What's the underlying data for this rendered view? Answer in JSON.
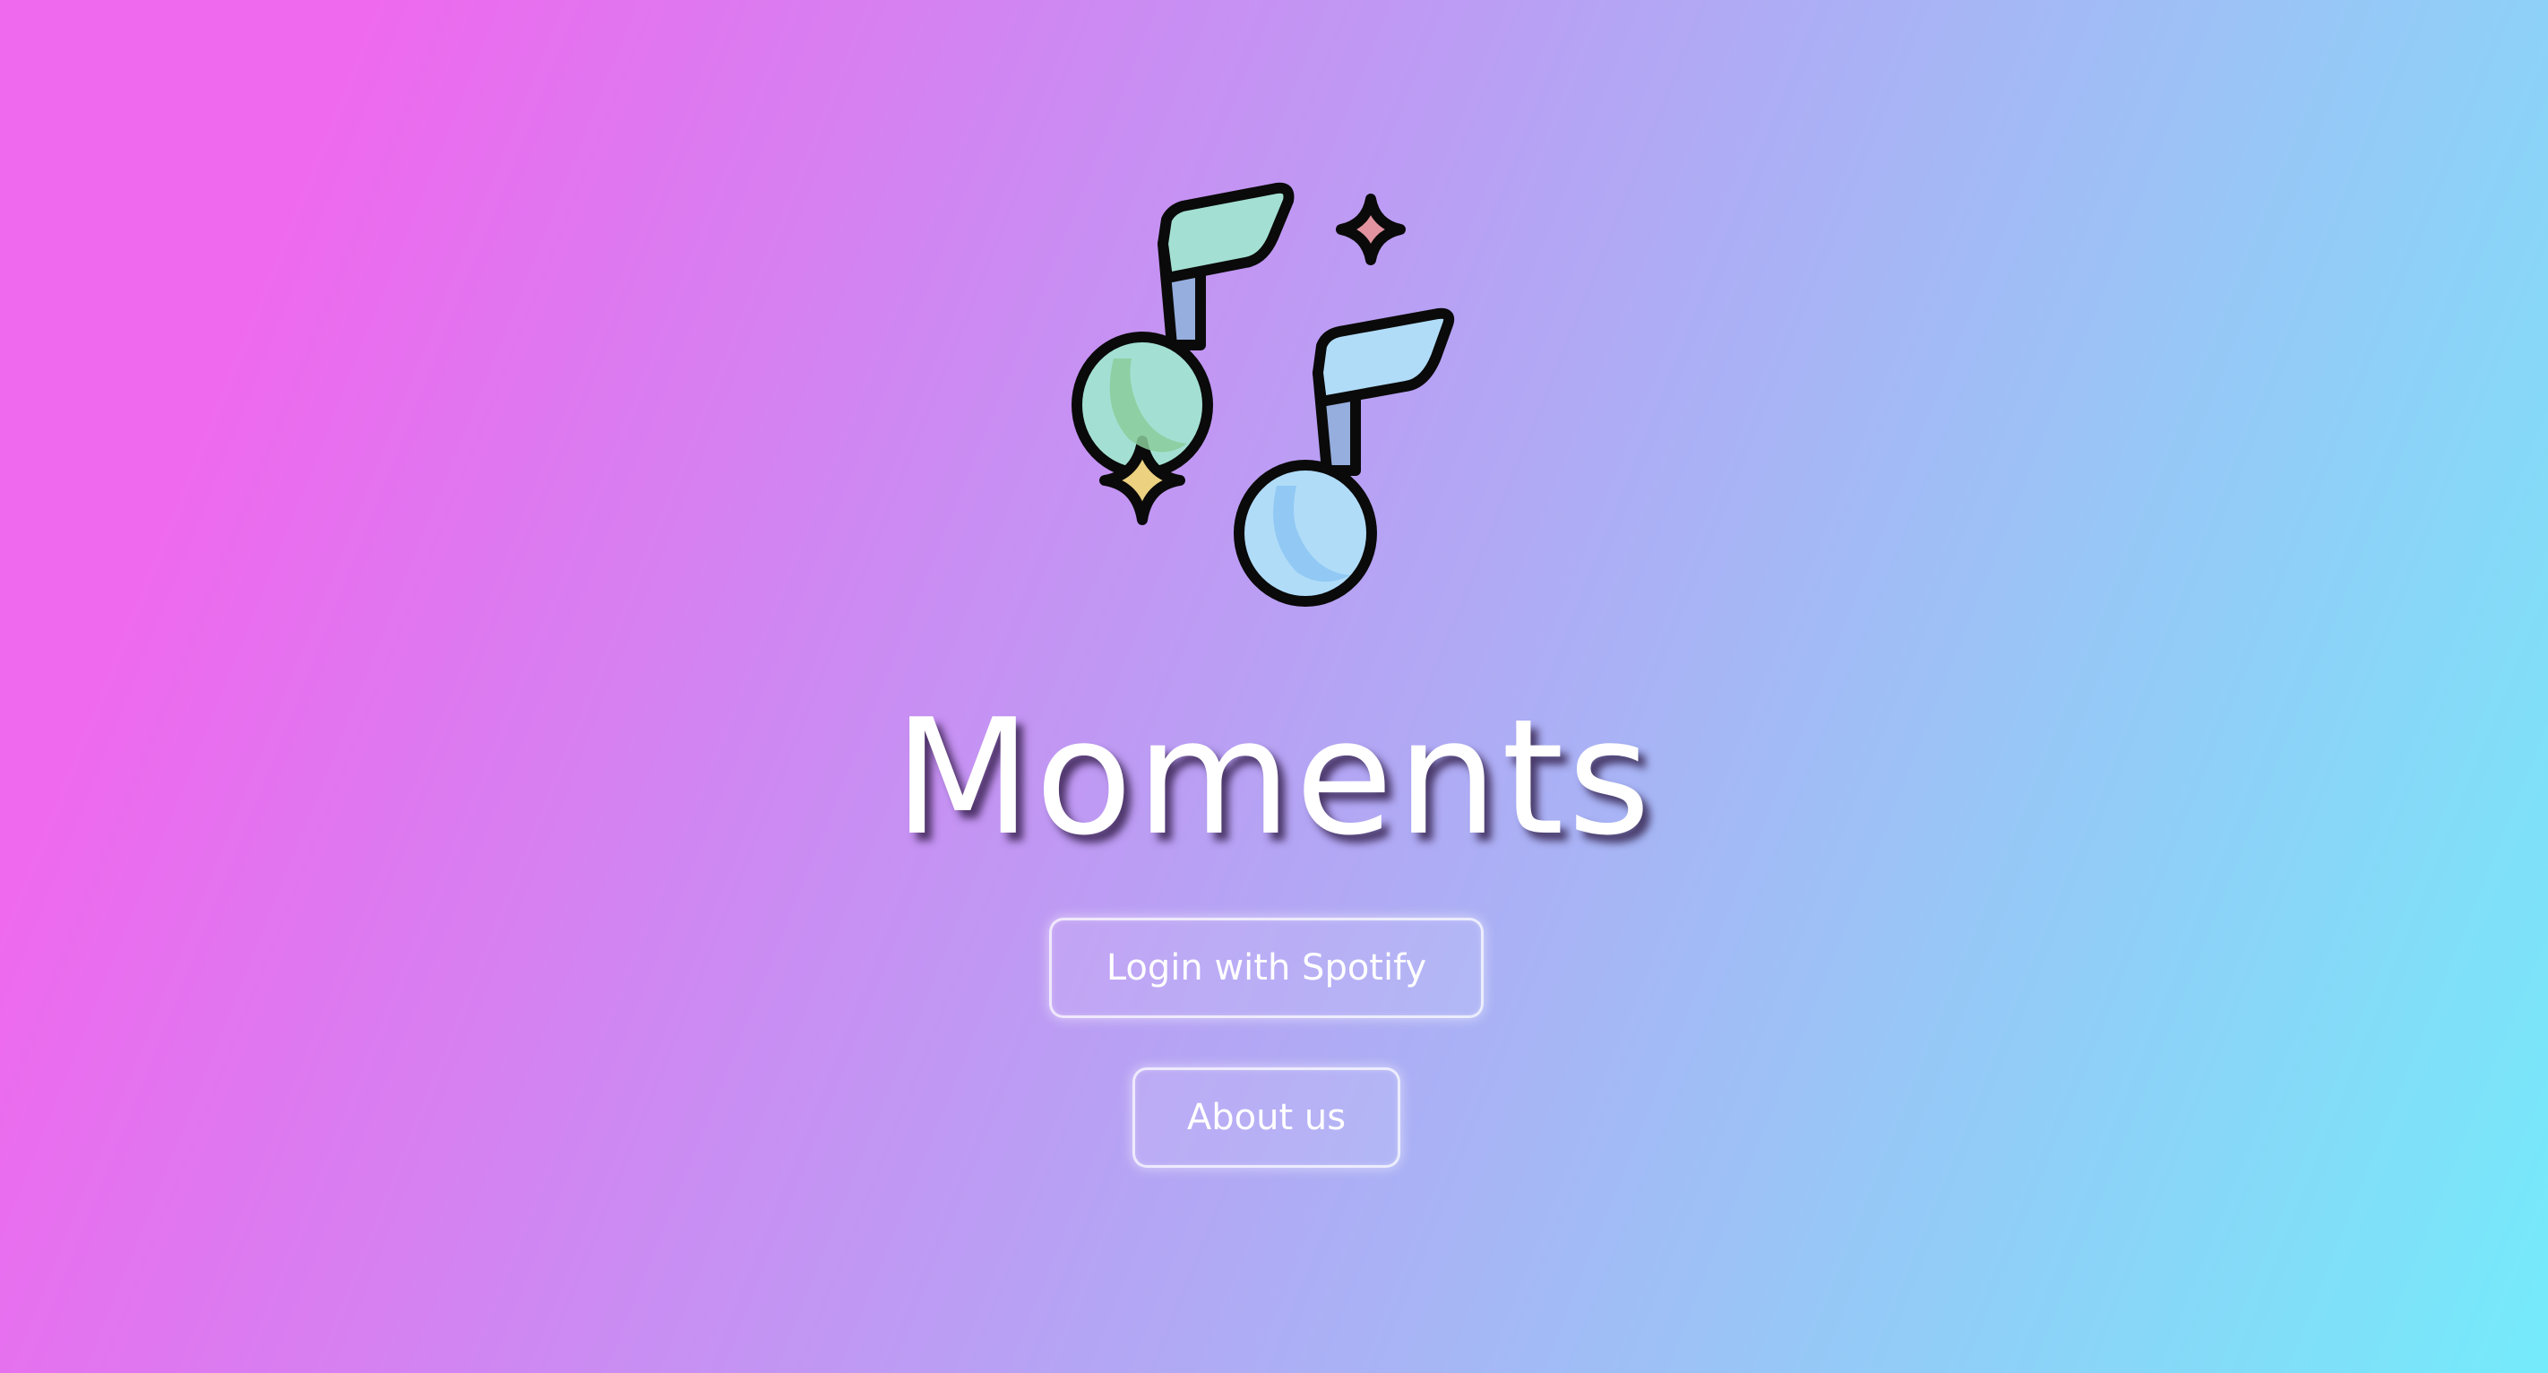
{
  "app": {
    "title": "Moments",
    "logo_icon": "music-notes-sparkles-icon"
  },
  "actions": {
    "login_label": "Login with Spotify",
    "about_label": "About us"
  },
  "colors": {
    "gradient_start": "#ee69ee",
    "gradient_end": "#74ebfa",
    "note_green": "#a3e0d3",
    "note_blue": "#b0dcf8",
    "sparkle_yellow": "#ecd181",
    "sparkle_pink": "#e3939f"
  }
}
